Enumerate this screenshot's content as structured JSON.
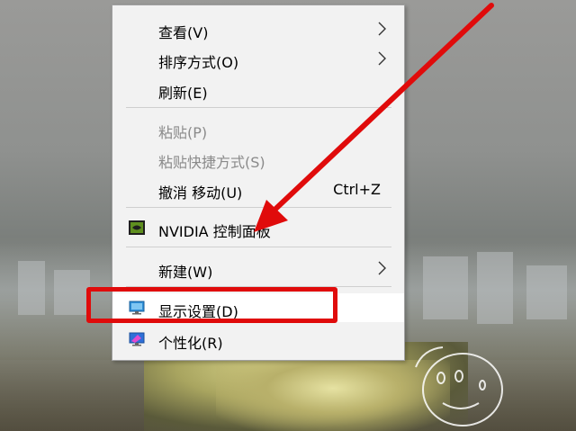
{
  "menu": {
    "items": [
      {
        "label": "查看(V)",
        "submenu": true
      },
      {
        "label": "排序方式(O)",
        "submenu": true
      },
      {
        "label": "刷新(E)"
      },
      {
        "label": "粘贴(P)",
        "disabled": true
      },
      {
        "label": "粘贴快捷方式(S)",
        "disabled": true
      },
      {
        "label": "撤消 移动(U)",
        "shortcut": "Ctrl+Z"
      },
      {
        "label": "NVIDIA 控制面板",
        "icon": "nvidia-icon"
      },
      {
        "label": "新建(W)",
        "submenu": true
      },
      {
        "label": "显示设置(D)",
        "icon": "display-settings-icon",
        "highlighted": true
      },
      {
        "label": "个性化(R)",
        "icon": "personalize-icon"
      }
    ]
  },
  "annotation": {
    "arrow_color": "#e00b0b",
    "box_color": "#e00b0b"
  }
}
